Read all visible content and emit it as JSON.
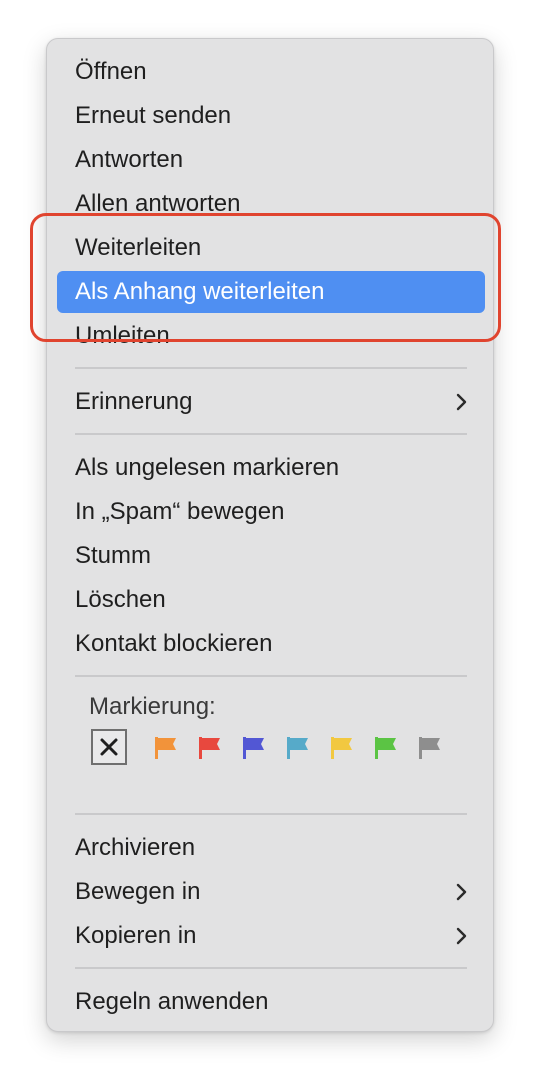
{
  "menu": {
    "items": [
      {
        "label": "Öffnen"
      },
      {
        "label": "Erneut senden"
      },
      {
        "label": "Antworten"
      },
      {
        "label": "Allen antworten"
      },
      {
        "label": "Weiterleiten"
      },
      {
        "label": "Als Anhang weiterleiten",
        "selected": true
      },
      {
        "label": "Umleiten"
      },
      {
        "label": "Erinnerung",
        "submenu": true
      },
      {
        "label": "Als ungelesen markieren"
      },
      {
        "label": "In „Spam“ bewegen"
      },
      {
        "label": "Stumm"
      },
      {
        "label": "Löschen"
      },
      {
        "label": "Kontakt blockieren"
      },
      {
        "label": "Archivieren"
      },
      {
        "label": "Bewegen in",
        "submenu": true
      },
      {
        "label": "Kopieren in",
        "submenu": true
      },
      {
        "label": "Regeln anwenden"
      }
    ],
    "flag_section": {
      "label": "Markierung:",
      "clear_symbol": "✕",
      "flags": [
        {
          "name": "orange",
          "color": "#f2933a"
        },
        {
          "name": "red",
          "color": "#e8483e"
        },
        {
          "name": "purple",
          "color": "#5257d4"
        },
        {
          "name": "blue",
          "color": "#56aac9"
        },
        {
          "name": "yellow",
          "color": "#f2c840"
        },
        {
          "name": "green",
          "color": "#5bc444"
        },
        {
          "name": "gray",
          "color": "#8e8e8e"
        }
      ]
    }
  },
  "colors": {
    "selection": "#4f8ff2",
    "annotation": "#e0442f"
  }
}
